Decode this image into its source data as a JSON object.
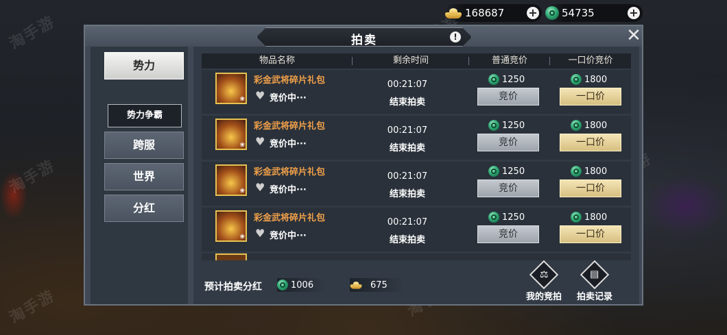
{
  "currency": {
    "gold": "168687",
    "jade": "54735",
    "gold_icon": "gold-ingot-icon",
    "jade_icon": "jade-coin-icon",
    "plus": "+"
  },
  "panel": {
    "title": "拍卖",
    "info": "!",
    "close": "✕"
  },
  "sidebar": {
    "items": [
      {
        "label": "势力"
      },
      {
        "label": "势力争霸"
      },
      {
        "label": "跨服"
      },
      {
        "label": "世界"
      },
      {
        "label": "分红"
      }
    ]
  },
  "table": {
    "headers": [
      "物品名称",
      "剩余时间",
      "普通竞价",
      "一口价竞价"
    ],
    "rows": [
      {
        "name": "彩金武将碎片礼包",
        "status": "竞价中···",
        "time": "00:21:07",
        "end": "结束拍卖",
        "normal_price": "1250",
        "fixed_price": "1800",
        "bid_label": "竞价",
        "fixed_label": "一口价"
      },
      {
        "name": "彩金武将碎片礼包",
        "status": "竞价中···",
        "time": "00:21:07",
        "end": "结束拍卖",
        "normal_price": "1250",
        "fixed_price": "1800",
        "bid_label": "竞价",
        "fixed_label": "一口价"
      },
      {
        "name": "彩金武将碎片礼包",
        "status": "竞价中···",
        "time": "00:21:07",
        "end": "结束拍卖",
        "normal_price": "1250",
        "fixed_price": "1800",
        "bid_label": "竞价",
        "fixed_label": "一口价"
      },
      {
        "name": "彩金武将碎片礼包",
        "status": "竞价中···",
        "time": "00:21:07",
        "end": "结束拍卖",
        "normal_price": "1250",
        "fixed_price": "1800",
        "bid_label": "竞价",
        "fixed_label": "一口价"
      }
    ]
  },
  "footer": {
    "label": "预计拍卖分红",
    "jade_value": "1006",
    "gold_value": "675",
    "my_bid": "我的竞拍",
    "record": "拍卖记录"
  },
  "watermark": {
    "brand": "淘手游"
  },
  "colors": {
    "item_name": "#f0a04a",
    "gold_button": "#e6d29a",
    "gray_button": "#b2b7bd",
    "panel": "#3f4854"
  }
}
